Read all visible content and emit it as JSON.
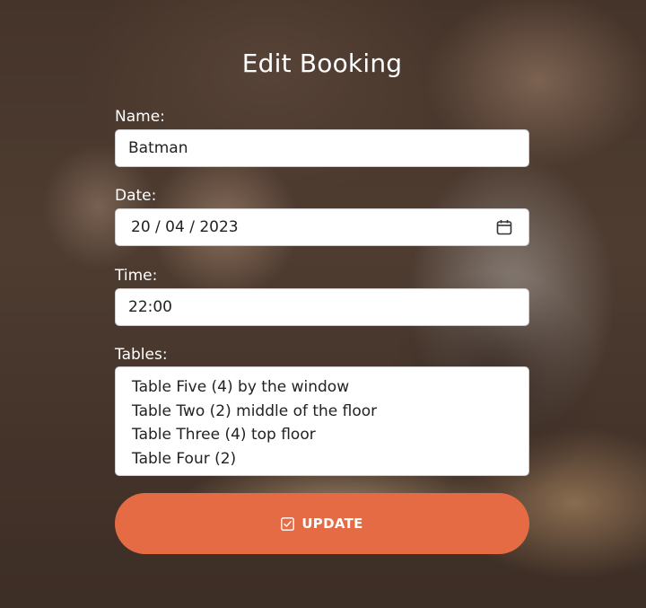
{
  "page": {
    "title": "Edit Booking"
  },
  "form": {
    "name": {
      "label": "Name:",
      "value": "Batman"
    },
    "date": {
      "label": "Date:",
      "value": "20 / 04 / 2023",
      "icon": "calendar-icon"
    },
    "time": {
      "label": "Time:",
      "value": "22:00"
    },
    "tables": {
      "label": "Tables:",
      "options": [
        "Table Five (4) by the window",
        "Table Two (2) middle of the floor",
        "Table Three (4) top floor",
        "Table Four (2)"
      ]
    },
    "submit": {
      "label": "UPDATE",
      "icon": "check-square-icon"
    }
  },
  "colors": {
    "accent": "#e56b45",
    "text_on_dark": "#ffffff",
    "input_bg": "#ffffff"
  }
}
